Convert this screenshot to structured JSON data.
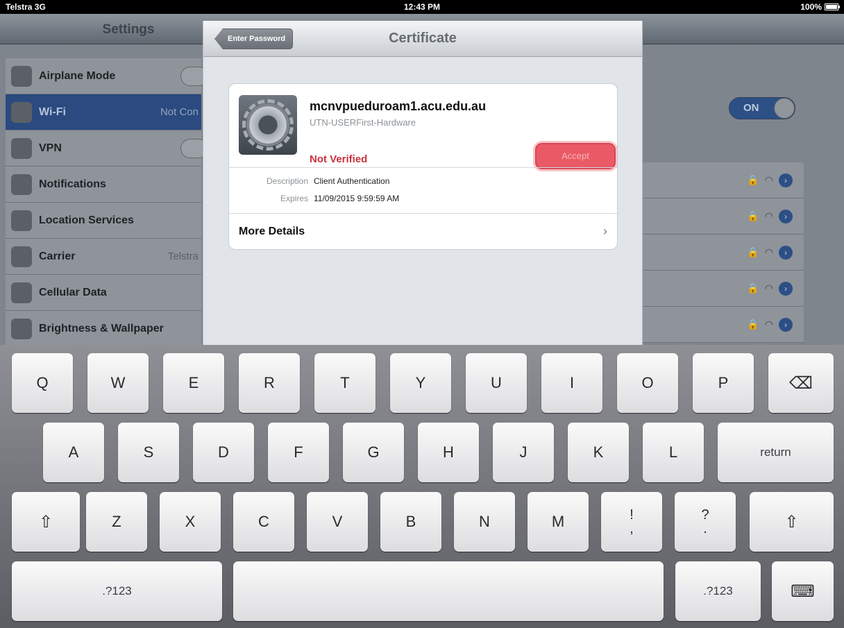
{
  "status": {
    "carrier": "Telstra 3G",
    "time": "12:43 PM",
    "battery": "100%"
  },
  "settings": {
    "title": "Settings",
    "items": [
      {
        "label": "Airplane Mode",
        "value": ""
      },
      {
        "label": "Wi-Fi",
        "value": "Not Con"
      },
      {
        "label": "VPN",
        "value": ""
      },
      {
        "label": "Notifications",
        "value": ""
      },
      {
        "label": "Location Services",
        "value": ""
      },
      {
        "label": "Carrier",
        "value": "Telstra"
      },
      {
        "label": "Cellular Data",
        "value": ""
      },
      {
        "label": "Brightness & Wallpaper",
        "value": ""
      }
    ],
    "wifi_toggle": "ON"
  },
  "modal": {
    "back_label": "Enter Password",
    "title": "Certificate",
    "cert": {
      "name": "mcnvpueduroam1.acu.edu.au",
      "issuer": "UTN-USERFirst-Hardware",
      "status": "Not Verified",
      "accept_label": "Accept",
      "description_key": "Description",
      "description_val": "Client Authentication",
      "expires_key": "Expires",
      "expires_val": "11/09/2015 9:59:59 AM",
      "more_label": "More Details"
    }
  },
  "keyboard": {
    "row1": [
      "Q",
      "W",
      "E",
      "R",
      "T",
      "Y",
      "U",
      "I",
      "O",
      "P"
    ],
    "row2": [
      "A",
      "S",
      "D",
      "F",
      "G",
      "H",
      "J",
      "K",
      "L"
    ],
    "row3": [
      "Z",
      "X",
      "C",
      "V",
      "B",
      "N",
      "M"
    ],
    "return_label": "return",
    "numbers_label": ".?123",
    "exclaim_top": "!",
    "exclaim_bottom": ",",
    "question_top": "?",
    "question_bottom": "."
  }
}
